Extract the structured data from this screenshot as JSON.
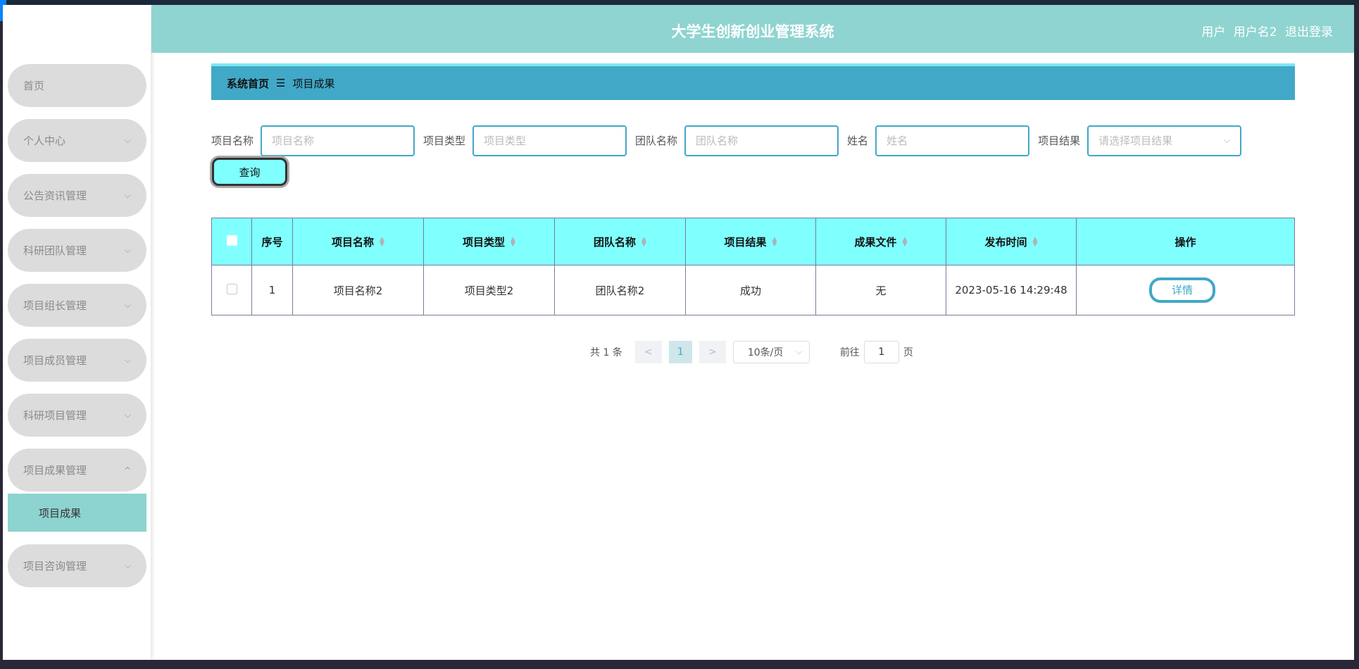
{
  "header": {
    "title": "大学生创新创业管理系统",
    "user_role": "用户",
    "username": "用户名2",
    "logout": "退出登录"
  },
  "sidebar": {
    "items": [
      {
        "label": "首页",
        "chevron": ""
      },
      {
        "label": "个人中心",
        "chevron": "⌵"
      },
      {
        "label": "公告资讯管理",
        "chevron": "⌵"
      },
      {
        "label": "科研团队管理",
        "chevron": "⌵"
      },
      {
        "label": "项目组长管理",
        "chevron": "⌵"
      },
      {
        "label": "项目成员管理",
        "chevron": "⌵"
      },
      {
        "label": "科研项目管理",
        "chevron": "⌵"
      },
      {
        "label": "项目成果管理",
        "chevron": "^"
      },
      {
        "label": "项目咨询管理",
        "chevron": "⌵"
      }
    ],
    "active_sub": "项目成果"
  },
  "breadcrumb": {
    "home": "系统首页",
    "sep": "☰",
    "current": "项目成果"
  },
  "search": {
    "fields": [
      {
        "label": "项目名称",
        "placeholder": "项目名称"
      },
      {
        "label": "项目类型",
        "placeholder": "项目类型"
      },
      {
        "label": "团队名称",
        "placeholder": "团队名称"
      },
      {
        "label": "姓名",
        "placeholder": "姓名"
      },
      {
        "label": "项目结果",
        "placeholder": "请选择项目结果"
      }
    ],
    "query_button": "查询"
  },
  "table": {
    "headers": [
      "序号",
      "项目名称",
      "项目类型",
      "团队名称",
      "项目结果",
      "成果文件",
      "发布时间",
      "操作"
    ],
    "rows": [
      {
        "index": "1",
        "name": "项目名称2",
        "type": "项目类型2",
        "team": "团队名称2",
        "result": "成功",
        "file": "无",
        "time": "2023-05-16 14:29:48",
        "action": "详情"
      }
    ]
  },
  "pagination": {
    "total": "共 1 条",
    "prev": "<",
    "current_page": "1",
    "next": ">",
    "page_size": "10条/页",
    "goto_prefix": "前往",
    "goto_value": "1",
    "goto_suffix": "页"
  },
  "colors": {
    "header_bg": "#8fd4d1",
    "breadcrumb_bg": "#41a8c7",
    "table_header_bg": "#80ffff",
    "accent": "#41a8c7"
  }
}
